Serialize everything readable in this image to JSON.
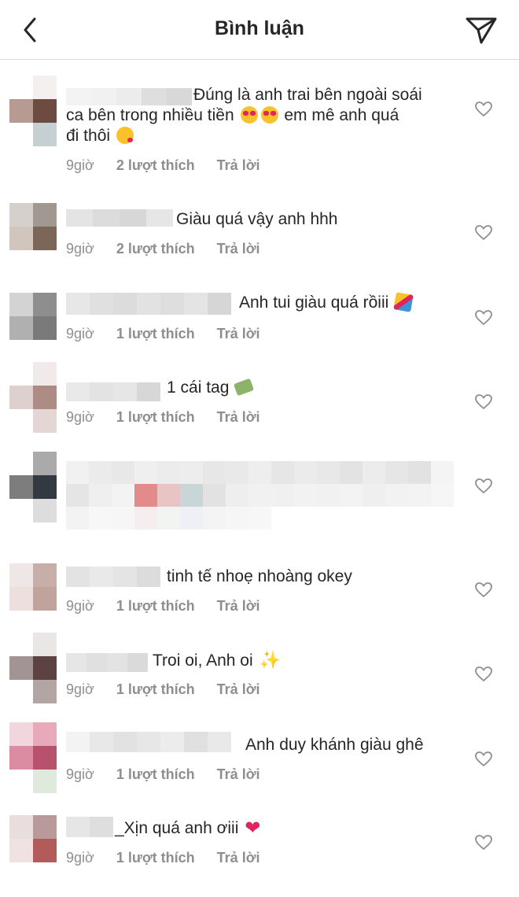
{
  "header": {
    "title": "Bình luận",
    "back_icon": "chevron-left-icon",
    "send_icon": "paper-plane-icon"
  },
  "comments": [
    {
      "text_line1": "Đúng là anh trai bên ngoài soái",
      "text_line2": "ca bên trong nhiều tiền",
      "text_line2b": "em mê anh quá",
      "text_line3": "đi thôi",
      "time": "9giờ",
      "likes": "2 lượt thích",
      "reply": "Trả lời"
    },
    {
      "text": "Giàu quá vậy anh hhh",
      "time": "9giờ",
      "likes": "2 lượt thích",
      "reply": "Trả lời"
    },
    {
      "text": "Anh tui giàu quá rồiii",
      "time": "9giờ",
      "likes": "1 lượt thích",
      "reply": "Trả lời"
    },
    {
      "text": "1 cái tag",
      "time": "9giờ",
      "likes": "1 lượt thích",
      "reply": "Trả lời"
    },
    {
      "time": "",
      "likes": "",
      "reply": ""
    },
    {
      "text": "tinh tế nhoẹ nhoàng okey",
      "time": "9giờ",
      "likes": "1 lượt thích",
      "reply": "Trả lời"
    },
    {
      "text": "Troi oi, Anh oi",
      "time": "9giờ",
      "likes": "1 lượt thích",
      "reply": "Trả lời"
    },
    {
      "text": "Anh duy khánh giàu ghê",
      "time": "9giờ",
      "likes": "1 lượt thích",
      "reply": "Trả lời"
    },
    {
      "text": "_Xịn quá anh ơiii",
      "time": "9giờ",
      "likes": "1 lượt thích",
      "reply": "Trả lời"
    }
  ],
  "colors": {
    "meta_gray": "#8e8e8e",
    "text": "#262626",
    "divider": "#dbdbdb"
  }
}
